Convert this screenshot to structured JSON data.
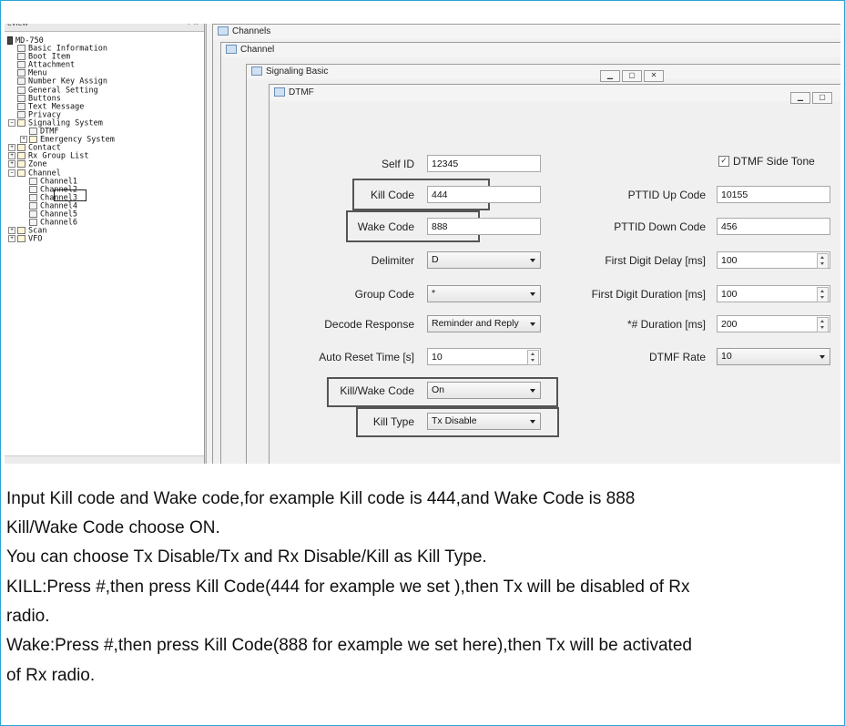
{
  "tree": {
    "header_title": "eview",
    "header_controls": "+ ×",
    "root": "MD-750",
    "items": [
      {
        "label": "Basic Information"
      },
      {
        "label": "Boot Item"
      },
      {
        "label": "Attachment"
      },
      {
        "label": "Menu"
      },
      {
        "label": "Number Key Assign"
      },
      {
        "label": "General Setting"
      },
      {
        "label": "Buttons"
      },
      {
        "label": "Text Message"
      },
      {
        "label": "Privacy"
      },
      {
        "label": "Signaling System"
      },
      {
        "label": "DTMF"
      },
      {
        "label": "Emergency System"
      },
      {
        "label": "Contact"
      },
      {
        "label": "Rx Group List"
      },
      {
        "label": "Zone"
      },
      {
        "label": "Channel"
      },
      {
        "label": "Channel1"
      },
      {
        "label": "Channel2"
      },
      {
        "label": "Channel3"
      },
      {
        "label": "Channel4"
      },
      {
        "label": "Channel5"
      },
      {
        "label": "Channel6"
      },
      {
        "label": "Scan"
      },
      {
        "label": "VFO"
      }
    ]
  },
  "windows": {
    "channels_title": "Channels",
    "channel_title": "Channel",
    "signaling_title": "Signaling Basic",
    "dtmf_title": "DTMF"
  },
  "form": {
    "self_id_label": "Self ID",
    "self_id_value": "12345",
    "kill_code_label": "Kill Code",
    "kill_code_value": "444",
    "wake_code_label": "Wake Code",
    "wake_code_value": "888",
    "delimiter_label": "Delimiter",
    "delimiter_value": "D",
    "group_code_label": "Group Code",
    "group_code_value": "*",
    "decode_response_label": "Decode Response",
    "decode_response_value": "Reminder and Reply",
    "auto_reset_label": "Auto Reset Time [s]",
    "auto_reset_value": "10",
    "kill_wake_label": "Kill/Wake Code",
    "kill_wake_value": "On",
    "kill_type_label": "Kill Type",
    "kill_type_value": "Tx Disable",
    "side_tone_label": "DTMF Side Tone",
    "side_tone_checked": true,
    "pttid_up_label": "PTTID Up Code",
    "pttid_up_value": "10155",
    "pttid_down_label": "PTTID Down Code",
    "pttid_down_value": "456",
    "first_digit_delay_label": "First Digit Delay [ms]",
    "first_digit_delay_value": "100",
    "first_digit_duration_label": "First Digit Duration [ms]",
    "first_digit_duration_value": "100",
    "hash_duration_label": "*# Duration [ms]",
    "hash_duration_value": "200",
    "dtmf_rate_label": "DTMF Rate",
    "dtmf_rate_value": "10"
  },
  "caption": {
    "line1": "Input Kill code and Wake code,for example Kill code is 444,and Wake Code is 888",
    "line2": "Kill/Wake Code choose ON.",
    "line3": "You can choose Tx Disable/Tx and Rx Disable/Kill as Kill Type.",
    "line4": "KILL:Press #,then press Kill Code(444 for example we set ),then Tx will be disabled of Rx",
    "line5": "radio.",
    "line6": "Wake:Press #,then press Kill Code(888 for example we set here),then Tx will be activated",
    "line7": "of Rx radio."
  }
}
